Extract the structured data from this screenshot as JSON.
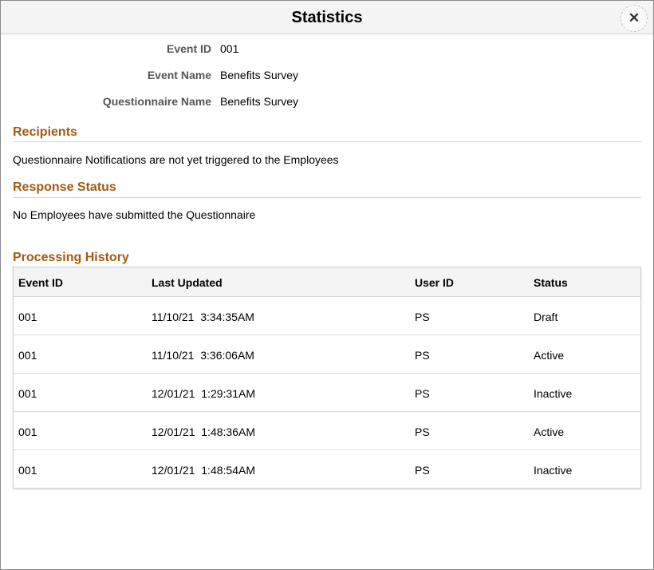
{
  "dialog": {
    "title": "Statistics",
    "close_icon": "close-icon",
    "close_glyph": "✕"
  },
  "fields": {
    "event_id": {
      "label": "Event ID",
      "value": "001"
    },
    "event_name": {
      "label": "Event Name",
      "value": "Benefits Survey"
    },
    "questionnaire_name": {
      "label": "Questionnaire Name",
      "value": "Benefits Survey"
    }
  },
  "recipients": {
    "heading": "Recipients",
    "message": "Questionnaire Notifications are not yet triggered to the Employees"
  },
  "response_status": {
    "heading": "Response Status",
    "message": "No Employees have submitted the Questionnaire"
  },
  "processing_history": {
    "heading": "Processing History",
    "columns": [
      "Event ID",
      "Last Updated",
      "User ID",
      "Status"
    ],
    "rows": [
      [
        "001",
        "11/10/21  3:34:35AM",
        "PS",
        "Draft"
      ],
      [
        "001",
        "11/10/21  3:36:06AM",
        "PS",
        "Active"
      ],
      [
        "001",
        "12/01/21  1:29:31AM",
        "PS",
        "Inactive"
      ],
      [
        "001",
        "12/01/21  1:48:36AM",
        "PS",
        "Active"
      ],
      [
        "001",
        "12/01/21  1:48:54AM",
        "PS",
        "Inactive"
      ]
    ]
  },
  "colors": {
    "section_heading": "#a35a10",
    "label_gray": "#555555",
    "title_bar_bg": "#f4f4f4"
  }
}
